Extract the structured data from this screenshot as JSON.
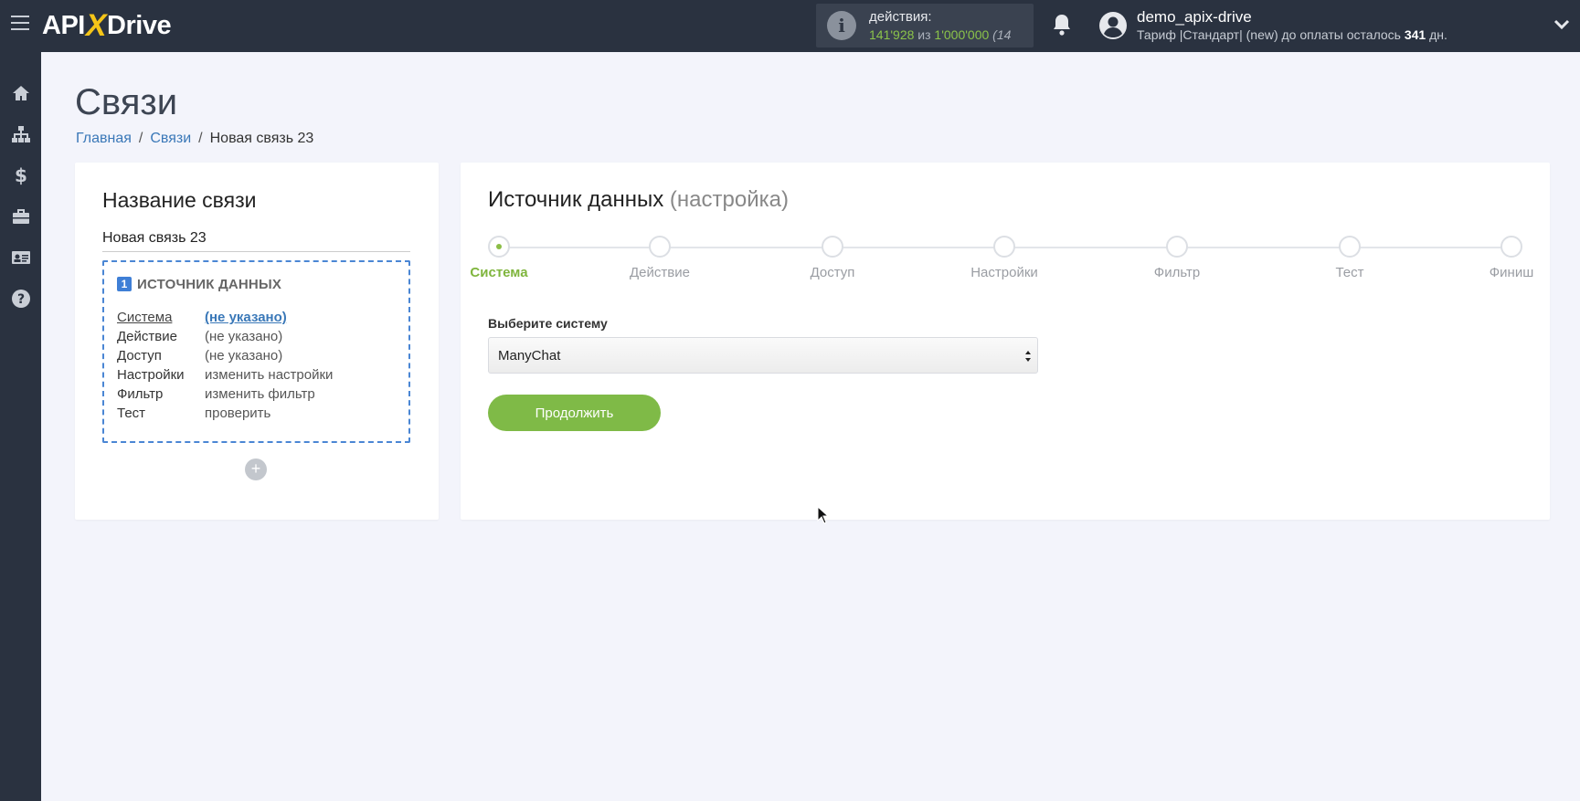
{
  "header": {
    "logo": {
      "part1": "API",
      "part2": "X",
      "part3": "Drive"
    },
    "actions": {
      "title": "действия:",
      "used": "141'928",
      "of_label": "из",
      "limit": "1'000'000",
      "extra": "(14"
    },
    "user": {
      "name": "demo_apix-drive",
      "plan_prefix": "Тариф |Стандарт| (new) до оплаты осталось ",
      "days": "341",
      "days_suffix": " дн."
    }
  },
  "sidebar": {
    "items": [
      {
        "icon": "home-icon"
      },
      {
        "icon": "sitemap-icon"
      },
      {
        "icon": "dollar-icon"
      },
      {
        "icon": "briefcase-icon"
      },
      {
        "icon": "id-card-icon"
      },
      {
        "icon": "help-icon"
      }
    ]
  },
  "page": {
    "title": "Связи",
    "breadcrumb": {
      "home": "Главная",
      "links": "Связи",
      "current": "Новая связь 23"
    }
  },
  "left_panel": {
    "title": "Название связи",
    "name_value": "Новая связь 23",
    "source": {
      "number": "1",
      "heading": "ИСТОЧНИК ДАННЫХ",
      "rows": [
        {
          "key": "Система",
          "value": "(не указано)"
        },
        {
          "key": "Действие",
          "value": "(не указано)"
        },
        {
          "key": "Доступ",
          "value": "(не указано)"
        },
        {
          "key": "Настройки",
          "value": "изменить настройки"
        },
        {
          "key": "Фильтр",
          "value": "изменить фильтр"
        },
        {
          "key": "Тест",
          "value": "проверить"
        }
      ]
    },
    "add_label": "+"
  },
  "right_panel": {
    "title": "Источник данных",
    "subtitle": "(настройка)",
    "steps": [
      {
        "label": "Система",
        "active": true
      },
      {
        "label": "Действие",
        "active": false
      },
      {
        "label": "Доступ",
        "active": false
      },
      {
        "label": "Настройки",
        "active": false
      },
      {
        "label": "Фильтр",
        "active": false
      },
      {
        "label": "Тест",
        "active": false
      },
      {
        "label": "Финиш",
        "active": false
      }
    ],
    "select_label": "Выберите систему",
    "select_value": "ManyChat",
    "continue_label": "Продолжить"
  },
  "colors": {
    "topbar": "#2a3240",
    "accent_green": "#7fba47",
    "link_blue": "#3a78b8",
    "dashed_border": "#4a86d4"
  }
}
